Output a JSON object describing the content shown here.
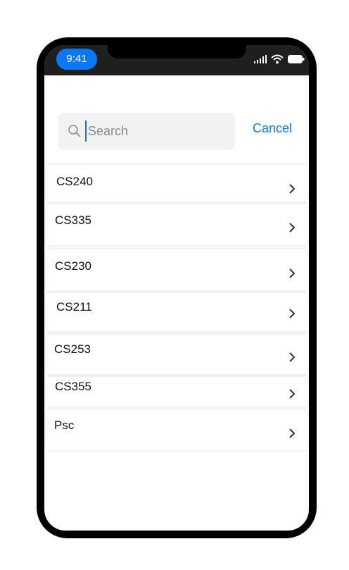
{
  "status_bar": {
    "time": "9:41",
    "icons": [
      "signal-icon",
      "wifi-icon",
      "battery-icon"
    ],
    "accent_color": "#0a78f5"
  },
  "search": {
    "placeholder": "Search",
    "value": "",
    "cancel_label": "Cancel"
  },
  "courses": [
    {
      "label": "CS240"
    },
    {
      "label": "CS335"
    },
    {
      "label": "CS230"
    },
    {
      "label": "CS211"
    },
    {
      "label": "CS253"
    },
    {
      "label": "CS355"
    },
    {
      "label": "Psc"
    }
  ]
}
